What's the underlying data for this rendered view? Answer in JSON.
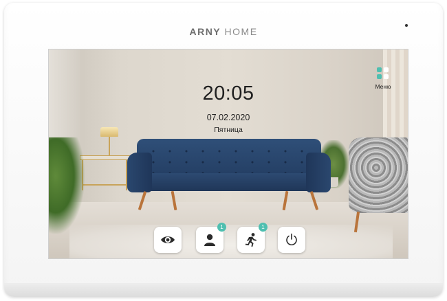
{
  "device": {
    "brand_bold": "ARNY",
    "brand_light": "HOME"
  },
  "screen": {
    "time": "20:05",
    "date": "07.02.2020",
    "weekday": "Пятница",
    "menu": {
      "label": "Меню",
      "icon": "menu-grid-icon"
    },
    "dock": [
      {
        "icon": "eye-icon",
        "badge": null
      },
      {
        "icon": "user-icon",
        "badge": "1"
      },
      {
        "icon": "running-person-icon",
        "badge": "1"
      },
      {
        "icon": "power-icon",
        "badge": null
      }
    ]
  },
  "colors": {
    "accent": "#4fbfb0",
    "icon_dark": "#2b2b2b",
    "sofa_blue": "#2a476e"
  }
}
